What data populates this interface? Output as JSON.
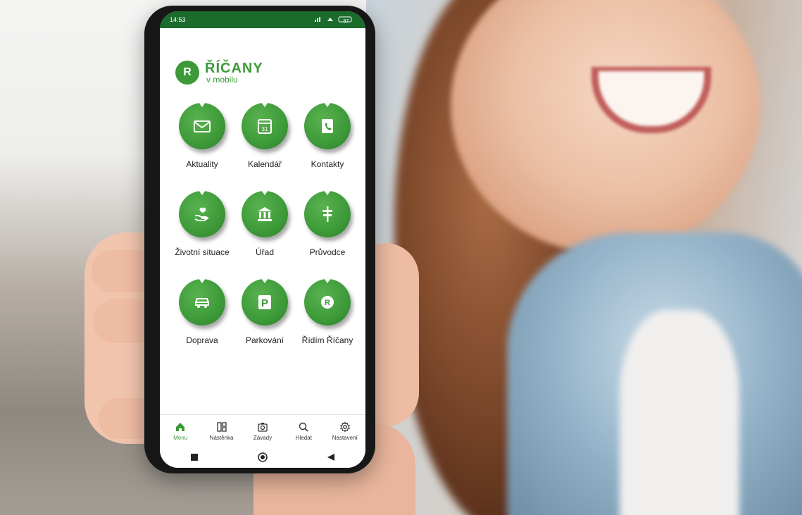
{
  "status_bar": {
    "time": "14:53",
    "battery": "97"
  },
  "logo": {
    "mark": "R",
    "title": "ŘÍČANY",
    "subtitle": "v mobilu"
  },
  "tiles": [
    {
      "label": "Aktuality",
      "icon": "mail-icon"
    },
    {
      "label": "Kalendář",
      "icon": "calendar-icon",
      "calendar_day": "31"
    },
    {
      "label": "Kontakty",
      "icon": "phone-book-icon"
    },
    {
      "label": "Životní situace",
      "icon": "heart-hand-icon"
    },
    {
      "label": "Úřad",
      "icon": "building-icon"
    },
    {
      "label": "Průvodce",
      "icon": "signpost-icon"
    },
    {
      "label": "Doprava",
      "icon": "car-icon"
    },
    {
      "label": "Parkování",
      "icon": "parking-icon",
      "parking_letter": "P"
    },
    {
      "label": "Řídím Říčany",
      "icon": "r-logo-icon",
      "r_letter": "R"
    }
  ],
  "bottom_nav": [
    {
      "label": "Menu",
      "icon": "home-icon",
      "active": true
    },
    {
      "label": "Nástěnka",
      "icon": "board-icon",
      "active": false
    },
    {
      "label": "Závady",
      "icon": "camera-report-icon",
      "active": false
    },
    {
      "label": "Hledat",
      "icon": "search-icon",
      "active": false
    },
    {
      "label": "Nastavení",
      "icon": "gear-icon",
      "active": false
    }
  ],
  "colors": {
    "brand_green": "#3d9a39",
    "status_green": "#1a6b2c"
  }
}
